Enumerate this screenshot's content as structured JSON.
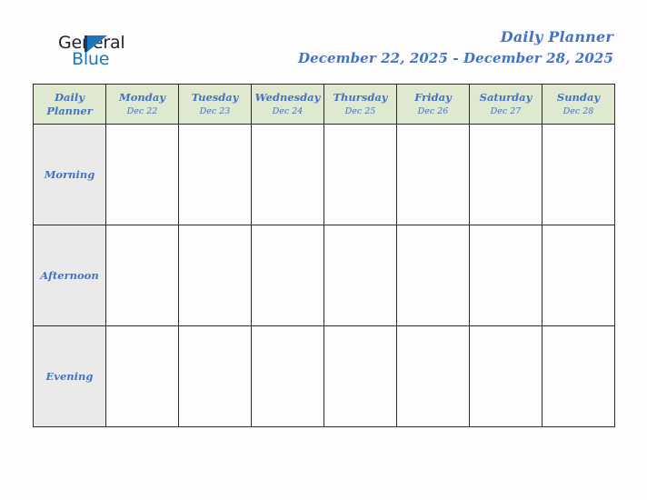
{
  "logo": {
    "word_top": "General",
    "word_bottom": "Blue",
    "mark": "triangle-logo-icon",
    "color_top": "#231f20",
    "color_bottom": "#1d76bb"
  },
  "header": {
    "title": "Daily Planner",
    "date_range": "December 22, 2025 - December 28, 2025",
    "accent_color": "#4472c4"
  },
  "table": {
    "corner": {
      "line1": "Daily",
      "line2": "Planner"
    },
    "header_bg": "#dfe9cf",
    "label_bg": "#eaeaea",
    "border_color": "#2b2b2b",
    "days": [
      {
        "name": "Monday",
        "date": "Dec 22"
      },
      {
        "name": "Tuesday",
        "date": "Dec 23"
      },
      {
        "name": "Wednesday",
        "date": "Dec 24"
      },
      {
        "name": "Thursday",
        "date": "Dec 25"
      },
      {
        "name": "Friday",
        "date": "Dec 26"
      },
      {
        "name": "Saturday",
        "date": "Dec 27"
      },
      {
        "name": "Sunday",
        "date": "Dec 28"
      }
    ],
    "rows": [
      {
        "label": "Morning",
        "entries": [
          "",
          "",
          "",
          "",
          "",
          "",
          ""
        ]
      },
      {
        "label": "Afternoon",
        "entries": [
          "",
          "",
          "",
          "",
          "",
          "",
          ""
        ]
      },
      {
        "label": "Evening",
        "entries": [
          "",
          "",
          "",
          "",
          "",
          "",
          ""
        ]
      }
    ]
  }
}
